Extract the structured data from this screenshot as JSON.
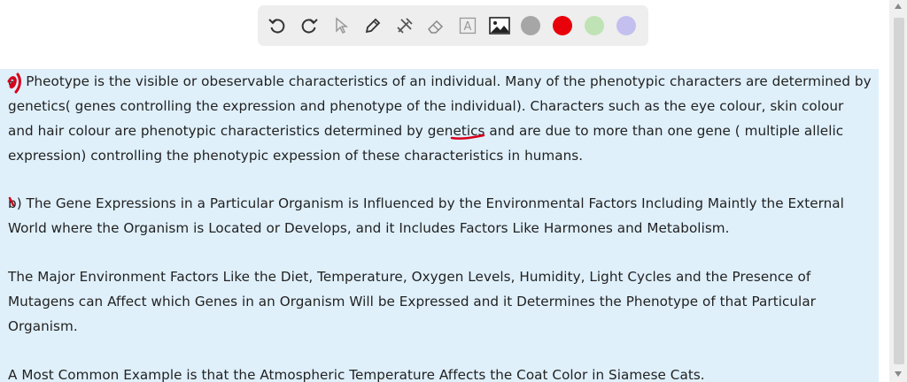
{
  "toolbar": {
    "tools": [
      "undo-icon",
      "redo-icon",
      "pointer-icon",
      "pen-icon",
      "tools-icon",
      "eraser-icon",
      "text-box-icon",
      "image-icon"
    ],
    "text_tool_label": "A",
    "colors": [
      "#a6a6a6",
      "#e8000b",
      "#bfe3b4",
      "#c3c0f0"
    ]
  },
  "document": {
    "paragraphs": [
      "a) Pheotype is the visible or obeservable characteristics of an individual. Many of the phenotypic characters are determined by genetics( genes controlling the expression and phenotype of the individual). Characters such as the eye colour, skin colour and hair colour are phenotypic characteristics determined by genetics and are due to more than one gene ( multiple allelic expression) controlling the phenotypic expession of these characteristics in humans.",
      "b) The Gene Expressions in a Particular Organism is Influenced by the Environmental Factors Including Maintly the External World where the Organism is Located or Develops, and it Includes Factors Like Harmones and Metabolism.",
      "The Major Environment Factors Like the Diet, Temperature, Oxygen Levels, Humidity, Light Cycles and the Presence of Mutagens can Affect which Genes in an Organism Will be Expressed and it Determines the Phenotype of that Particular Organism.",
      "A Most Common Example is that the Atmospheric Temperature Affects the Coat Color in Siamese Cats."
    ]
  },
  "annotations": {
    "ink_color": "#d7001a"
  }
}
